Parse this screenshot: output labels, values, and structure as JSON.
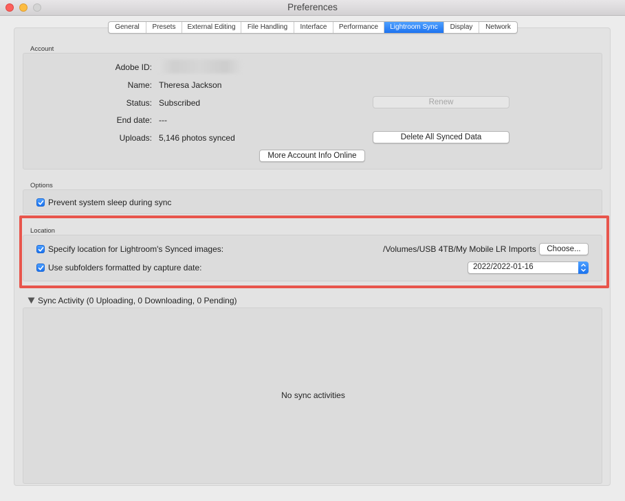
{
  "window": {
    "title": "Preferences"
  },
  "tabs": [
    {
      "label": "General",
      "active": false
    },
    {
      "label": "Presets",
      "active": false
    },
    {
      "label": "External Editing",
      "active": false
    },
    {
      "label": "File Handling",
      "active": false
    },
    {
      "label": "Interface",
      "active": false
    },
    {
      "label": "Performance",
      "active": false
    },
    {
      "label": "Lightroom Sync",
      "active": true
    },
    {
      "label": "Display",
      "active": false
    },
    {
      "label": "Network",
      "active": false
    }
  ],
  "account": {
    "section_title": "Account",
    "adobe_id_label": "Adobe ID:",
    "name_label": "Name:",
    "name_value": "Theresa Jackson",
    "status_label": "Status:",
    "status_value": "Subscribed",
    "end_date_label": "End date:",
    "end_date_value": "---",
    "uploads_label": "Uploads:",
    "uploads_value": "5,146 photos synced",
    "renew_button": "Renew",
    "delete_button": "Delete All Synced Data",
    "more_info_button": "More Account Info Online"
  },
  "options": {
    "section_title": "Options",
    "prevent_sleep_label": "Prevent system sleep during sync",
    "prevent_sleep_checked": true
  },
  "location": {
    "section_title": "Location",
    "specify_label": "Specify location for Lightroom's Synced images:",
    "specify_checked": true,
    "path_value": "/Volumes/USB 4TB/My Mobile LR Imports",
    "choose_button": "Choose...",
    "subfolders_label": "Use subfolders formatted by capture date:",
    "subfolders_checked": true,
    "date_format_value": "2022/2022-01-16"
  },
  "sync_activity": {
    "header": "Sync Activity  (0 Uploading, 0 Downloading, 0 Pending)",
    "empty_message": "No sync activities"
  },
  "colors": {
    "accent": "#1d73f0",
    "highlight": "#e8554c"
  }
}
